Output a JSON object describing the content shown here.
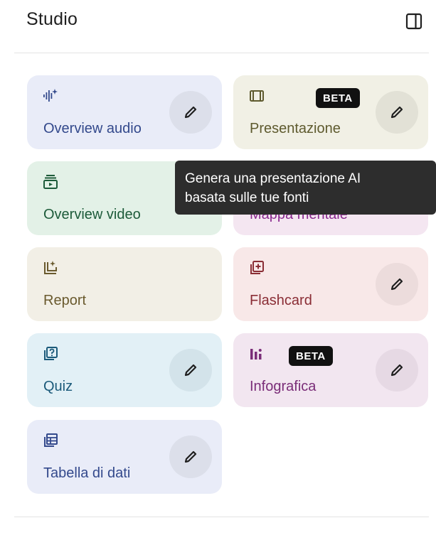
{
  "header": {
    "title": "Studio",
    "panel_icon": "panel-toggle-icon"
  },
  "cards": {
    "audio": {
      "label": "Overview audio",
      "icon": "audio-waveform-icon",
      "color": "#33498c",
      "bg": "#e9ecf8",
      "edit_bg": "#dcdfea"
    },
    "presentation": {
      "label": "Presentazione",
      "icon": "slides-icon",
      "badge": "BETA",
      "color": "#5e5a2e",
      "bg": "#f1f0e5",
      "edit_bg": "#e2e1d6"
    },
    "video": {
      "label": "Overview video",
      "icon": "video-overview-icon",
      "color": "#1d5b3a",
      "bg": "#e3f1e7"
    },
    "mindmap": {
      "label": "Mappa mentale",
      "icon": "mind-map-icon",
      "color": "#8a2a8f",
      "bg": "#f4e6f1"
    },
    "report": {
      "label": "Report",
      "icon": "report-icon",
      "color": "#6a5a2e",
      "bg": "#f2efe6"
    },
    "flashcard": {
      "label": "Flashcard",
      "icon": "flashcard-icon",
      "color": "#8a2d35",
      "bg": "#f8e8e8",
      "edit_bg": "#ecdcdc"
    },
    "quiz": {
      "label": "Quiz",
      "icon": "quiz-icon",
      "color": "#1b5a7a",
      "bg": "#e2f0f6",
      "edit_bg": "#d3e3ea"
    },
    "infographic": {
      "label": "Infografica",
      "icon": "infographic-icon",
      "badge": "BETA",
      "color": "#7a2d78",
      "bg": "#f2e6f0",
      "edit_bg": "#e6d9e4"
    },
    "datatable": {
      "label": "Tabella di dati",
      "icon": "data-table-icon",
      "color": "#33498c",
      "bg": "#e9ecf8",
      "edit_bg": "#dcdfea"
    }
  },
  "tooltip": {
    "line1": "Genera una presentazione AI",
    "line2": "basata sulle tue fonti"
  }
}
